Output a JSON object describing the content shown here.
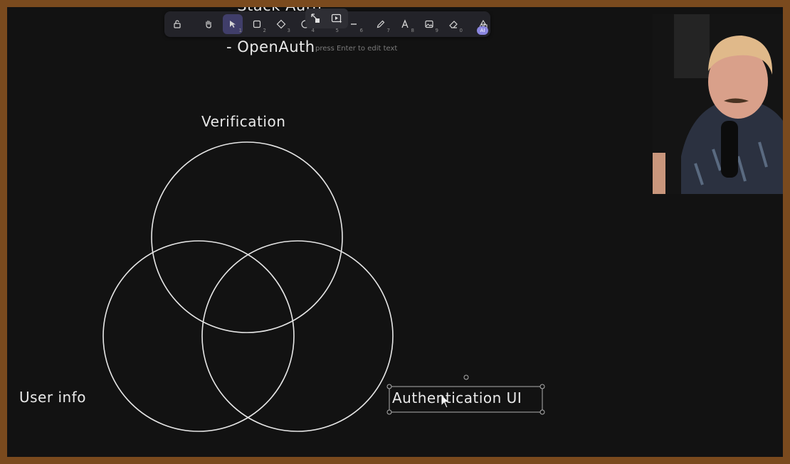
{
  "canvas": {
    "list_items": [
      "- Stack Auth",
      "- OpenAuth"
    ],
    "hint": "press Enter to edit text",
    "labels": {
      "verification": "Verification",
      "user_info": "User info",
      "auth_ui": "Authentication UI"
    }
  },
  "toolbar": {
    "tools": [
      {
        "name": "lock",
        "key": ""
      },
      {
        "name": "hand",
        "key": ""
      },
      {
        "name": "selection",
        "key": "1"
      },
      {
        "name": "rectangle",
        "key": "2"
      },
      {
        "name": "diamond",
        "key": "3"
      },
      {
        "name": "ellipse",
        "key": "4"
      },
      {
        "name": "arrow",
        "key": "5"
      },
      {
        "name": "line",
        "key": "6"
      },
      {
        "name": "pencil",
        "key": "7"
      },
      {
        "name": "text",
        "key": "8"
      },
      {
        "name": "image",
        "key": "9"
      },
      {
        "name": "eraser",
        "key": "0"
      },
      {
        "name": "shapes",
        "key": ""
      }
    ],
    "ai_badge": "AI"
  },
  "colors": {
    "background": "#121212",
    "stroke": "#e6e6e6",
    "toolbar": "#232329",
    "active_tool": "#403e6a",
    "selection": "#b0b0b0"
  }
}
